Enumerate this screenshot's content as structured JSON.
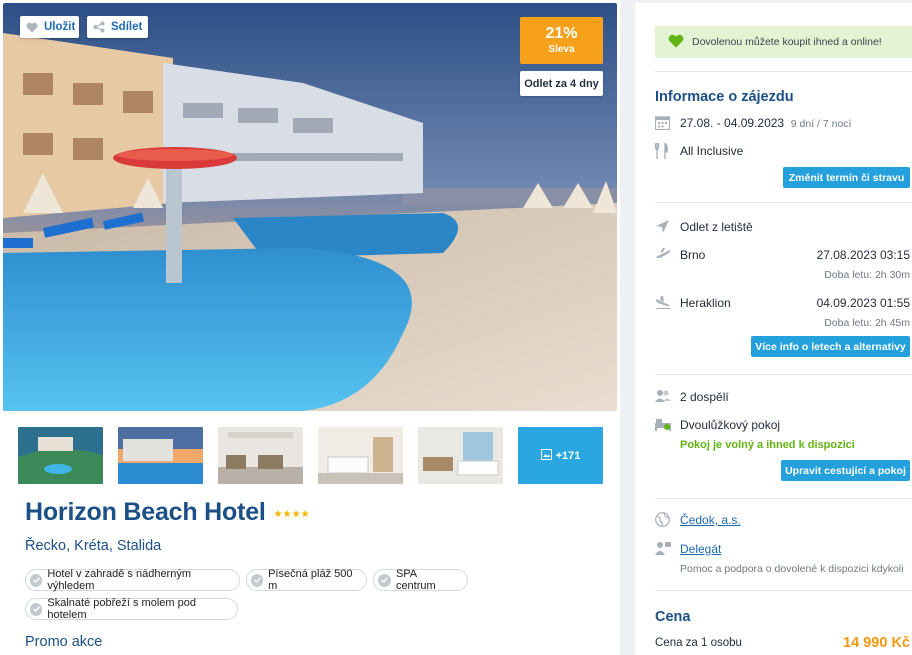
{
  "hero": {
    "save_label": "Uložit",
    "share_label": "Sdílet",
    "discount_percent": "21%",
    "discount_label": "Sleva",
    "departure_badge": "Odlet za 4 dny"
  },
  "gallery": {
    "more_count": "+171"
  },
  "hotel": {
    "name": "Horizon Beach Hotel",
    "stars": 4,
    "stars_display": "★★★★",
    "location": "Řecko, Kréta, Stalida",
    "tags": [
      "Hotel v zahradě s nádherným výhledem",
      "Písečná pláž 500 m",
      "SPA centrum",
      "Skalnaté pobřeží s molem pod hotelem"
    ],
    "promo_title": "Promo akce"
  },
  "sidebar": {
    "online_notice": "Dovolenou můžete koupit ihned a online!",
    "info_title": "Informace o zájezdu",
    "dates": "27.08. - 04.09.2023",
    "duration": "9 dní / 7 nocí",
    "board": "All Inclusive",
    "change_term_button": "Změnit termín či stravu",
    "departure_title": "Odlet z letiště",
    "flights": [
      {
        "city": "Brno",
        "datetime": "27.08.2023  03:15",
        "duration": "Doba letu: 2h 30m"
      },
      {
        "city": "Heraklion",
        "datetime": "04.09.2023  01:55",
        "duration": "Doba letu: 2h 45m"
      }
    ],
    "flight_info_button": "Více info o letech a alternativy",
    "travellers": "2 dospělí",
    "room": "Dvoulůžkový pokoj",
    "room_status": "Pokoj je volný a ihned k dispozici",
    "edit_travellers_button": "Upravit cestující a pokoj",
    "operator": "Čedok, a.s.",
    "delegate": "Delegát",
    "delegate_note": "Pomoc a podpora o dovolené k dispozici kdykoli",
    "price_title": "Cena",
    "price_per_person_label": "Cena za 1 osobu",
    "price_per_person": "14 990 Kč"
  },
  "colors": {
    "brand_blue": "#1c4f86",
    "button_blue": "#24a0dc",
    "discount_orange": "#f7a11a",
    "price_orange": "#f29a11",
    "available_green": "#62b414"
  }
}
